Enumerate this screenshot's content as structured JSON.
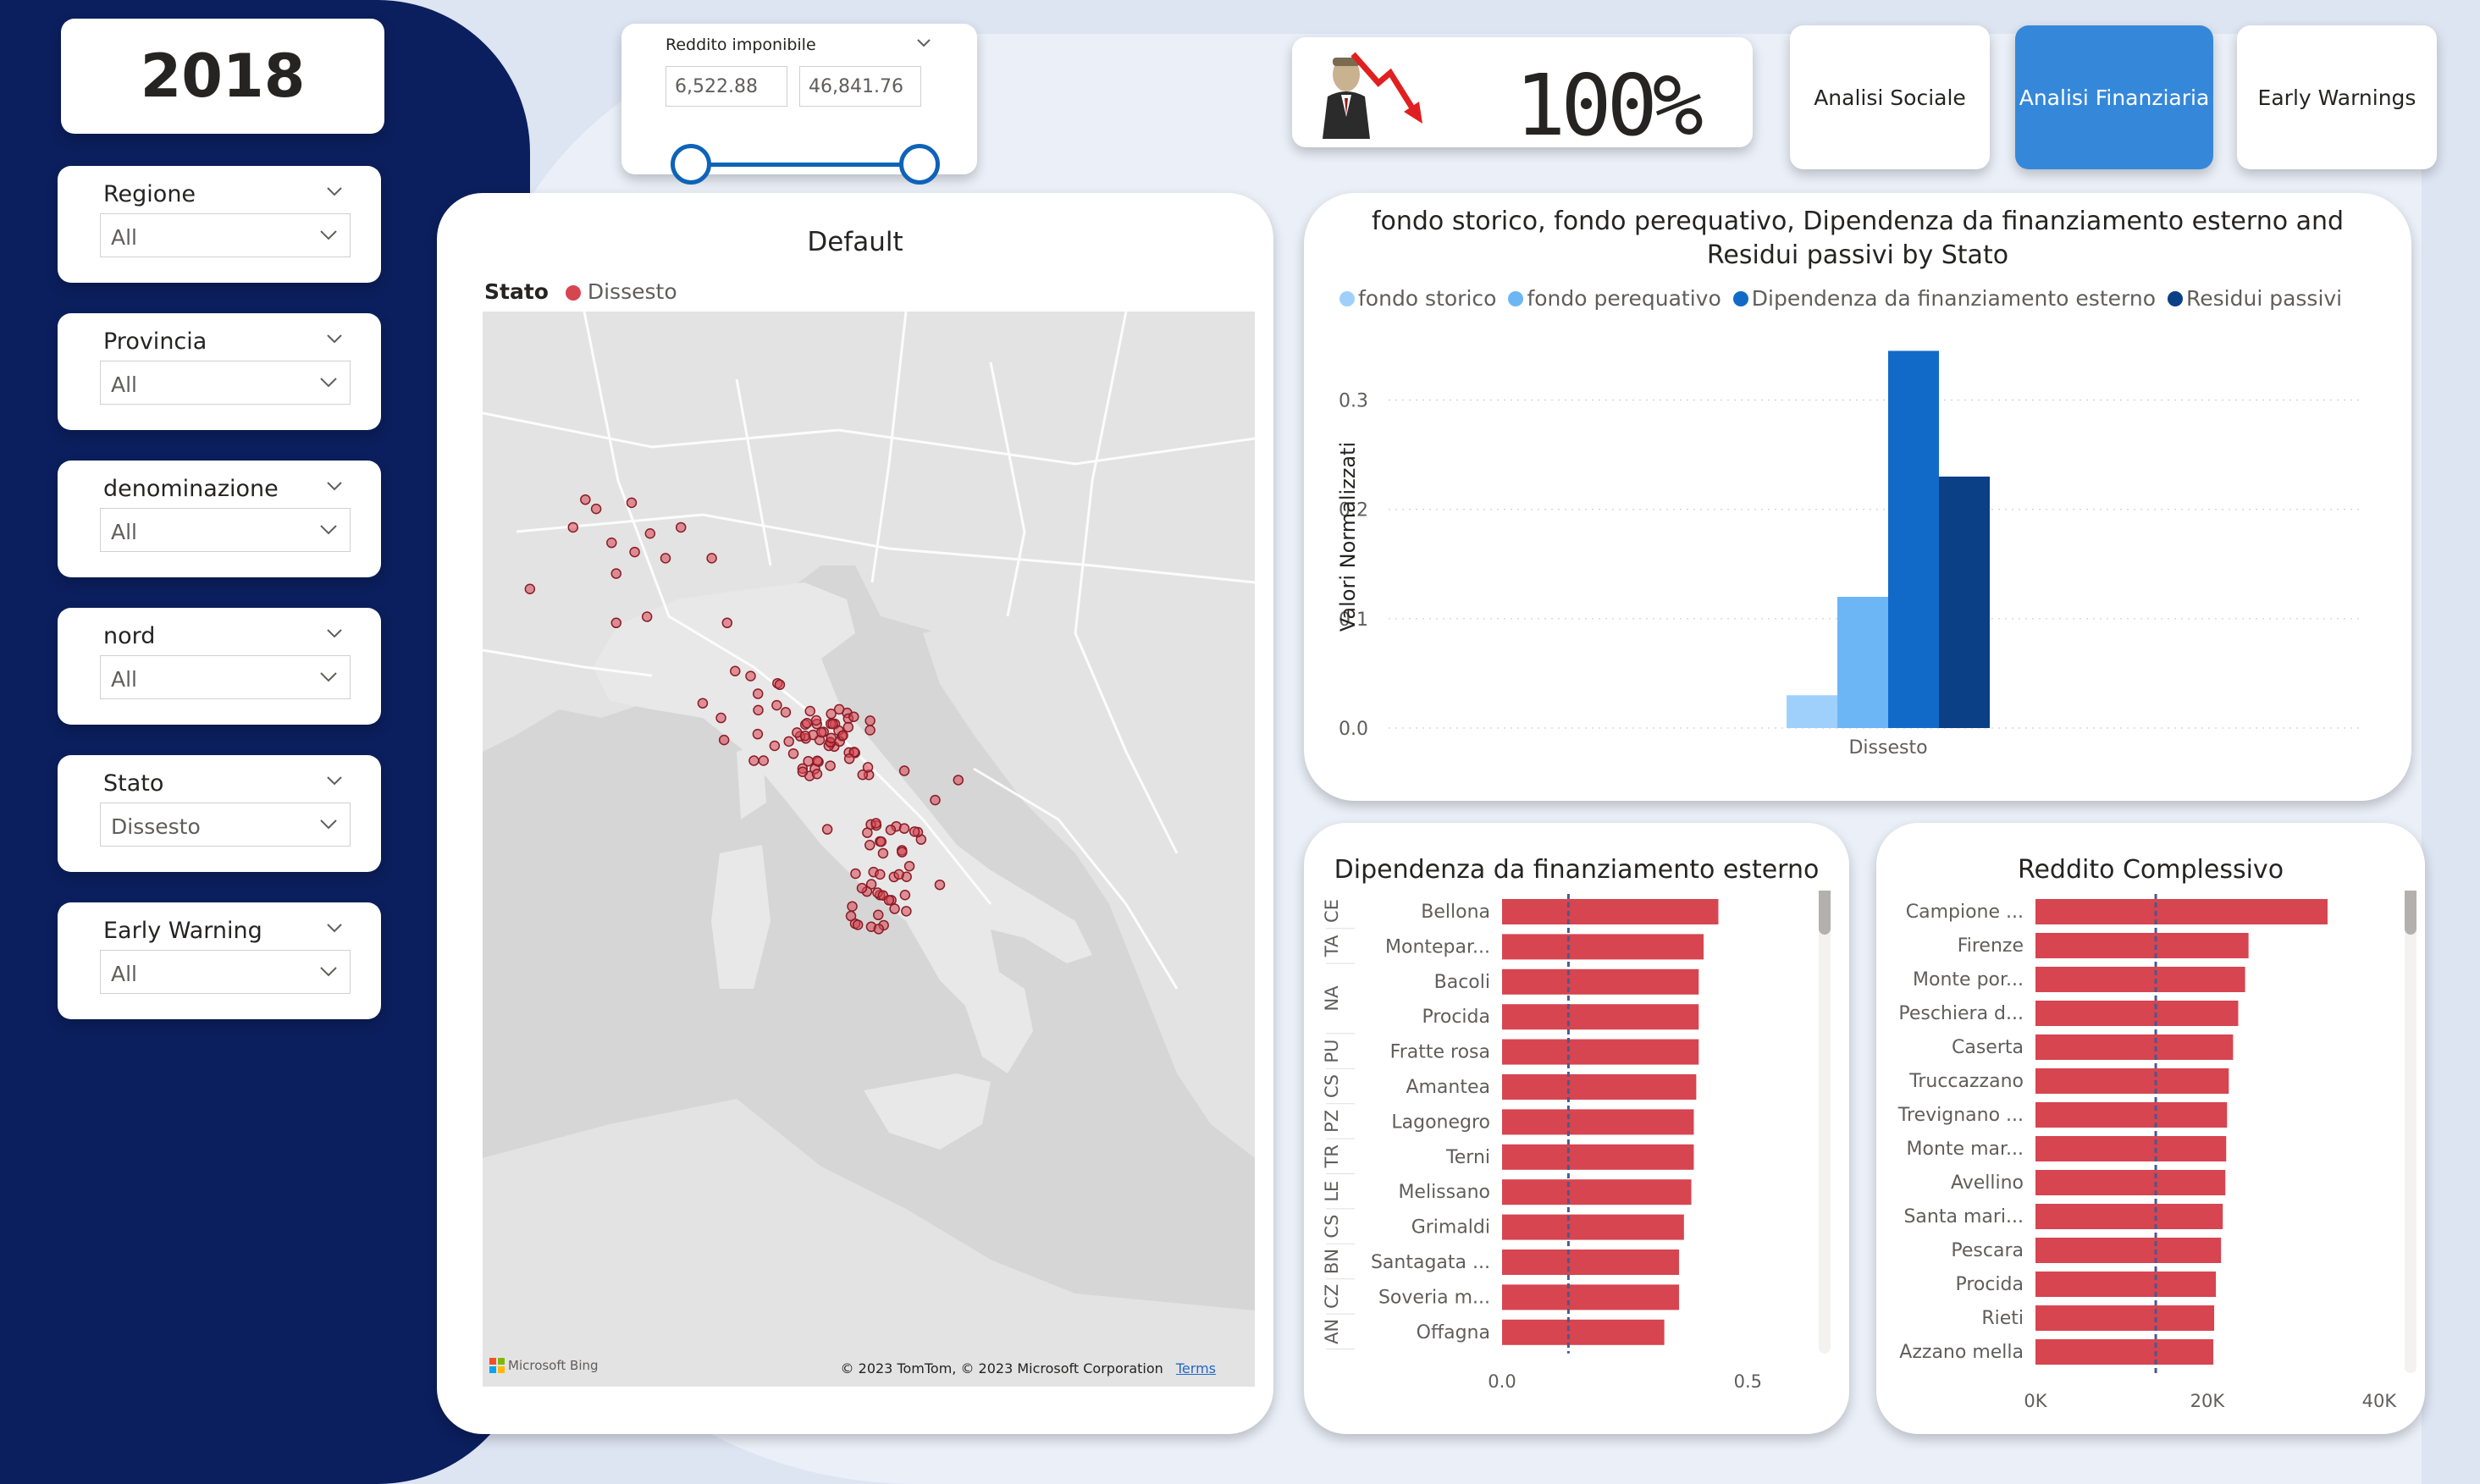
{
  "year": "2018",
  "slicers": [
    {
      "title": "Regione",
      "value": "All"
    },
    {
      "title": "Provincia",
      "value": "All"
    },
    {
      "title": "denominazione",
      "value": "All"
    },
    {
      "title": "nord",
      "value": "All"
    },
    {
      "title": "Stato",
      "value": "Dissesto"
    },
    {
      "title": "Early Warning",
      "value": "All"
    }
  ],
  "range_slicer": {
    "title": "Reddito imponibile",
    "min": "6,522.88",
    "max": "46,841.76"
  },
  "kpi": {
    "value": "100%"
  },
  "nav": [
    {
      "label": "Analisi Sociale",
      "active": false
    },
    {
      "label": "Analisi Finanziaria",
      "active": true
    },
    {
      "label": "Early Warnings",
      "active": false
    }
  ],
  "map": {
    "title": "Default",
    "legend_title": "Stato",
    "legend_item": "Dissesto",
    "legend_color": "#d64550",
    "attribution_left": "Microsoft Bing",
    "attribution_right": "© 2023 TomTom, © 2023 Microsoft Corporation",
    "terms": "Terms"
  },
  "colors": {
    "sidebar": "#0b1f5e",
    "accent": "#3588d9",
    "bar_red": "#d64550"
  },
  "chart_data": [
    {
      "type": "bar",
      "title": "fondo storico, fondo perequativo, Dipendenza da finanziamento esterno and Residui passivi by Stato",
      "ylabel": "Valori Normalizzati",
      "categories": [
        "Dissesto"
      ],
      "ylim": [
        0,
        0.35
      ],
      "yticks": [
        "0.0",
        "0.1",
        "0.2",
        "0.3"
      ],
      "series": [
        {
          "name": "fondo storico",
          "color": "#9fd0fb",
          "values": [
            0.03
          ]
        },
        {
          "name": "fondo perequativo",
          "color": "#6cb6f5",
          "values": [
            0.12
          ]
        },
        {
          "name": "Dipendenza da finanziamento esterno",
          "color": "#126ac8",
          "values": [
            0.345
          ]
        },
        {
          "name": "Residui passivi",
          "color": "#0b3f86",
          "values": [
            0.23
          ]
        }
      ],
      "legend": "top-left"
    },
    {
      "type": "bar",
      "orientation": "horizontal",
      "title": "Dipendenza da finanziamento esterno",
      "categories": [
        "Bellona",
        "Montepar...",
        "Bacoli",
        "Procida",
        "Fratte rosa",
        "Amantea",
        "Lagonegro",
        "Terni",
        "Melissano",
        "Grimaldi",
        "Santagata ...",
        "Soveria m...",
        "Offagna"
      ],
      "groups": [
        {
          "label": "CE",
          "rows": [
            0
          ]
        },
        {
          "label": "TA",
          "rows": [
            1
          ]
        },
        {
          "label": "NA",
          "rows": [
            2,
            3
          ]
        },
        {
          "label": "PU",
          "rows": [
            4
          ]
        },
        {
          "label": "CS",
          "rows": [
            5
          ]
        },
        {
          "label": "PZ",
          "rows": [
            6
          ]
        },
        {
          "label": "TR",
          "rows": [
            7
          ]
        },
        {
          "label": "LE",
          "rows": [
            8
          ]
        },
        {
          "label": "CS",
          "rows": [
            9
          ]
        },
        {
          "label": "BN",
          "rows": [
            10
          ]
        },
        {
          "label": "CZ",
          "rows": [
            11
          ]
        },
        {
          "label": "AN",
          "rows": [
            12
          ]
        }
      ],
      "values": [
        0.44,
        0.41,
        0.4,
        0.4,
        0.4,
        0.395,
        0.39,
        0.39,
        0.385,
        0.37,
        0.36,
        0.36,
        0.33
      ],
      "xlim": [
        0,
        0.62
      ],
      "xticks": [
        "0.0",
        "0.5"
      ],
      "average_line": 0.135,
      "color": "#d64550"
    },
    {
      "type": "bar",
      "orientation": "horizontal",
      "title": "Reddito Complessivo",
      "categories": [
        "Campione ...",
        "Firenze",
        "Monte por...",
        "Peschiera d...",
        "Caserta",
        "Truccazzano",
        "Trevignano ...",
        "Monte mar...",
        "Avellino",
        "Santa mari...",
        "Pescara",
        "Procida",
        "Rieti",
        "Azzano mella"
      ],
      "values": [
        34000,
        24800,
        24400,
        23600,
        23000,
        22500,
        22300,
        22200,
        22100,
        21800,
        21600,
        21000,
        20800,
        20700
      ],
      "xlim": [
        0,
        41000
      ],
      "xticks": [
        "0K",
        "20K",
        "40K"
      ],
      "average_line": 14000,
      "color": "#d64550"
    }
  ]
}
